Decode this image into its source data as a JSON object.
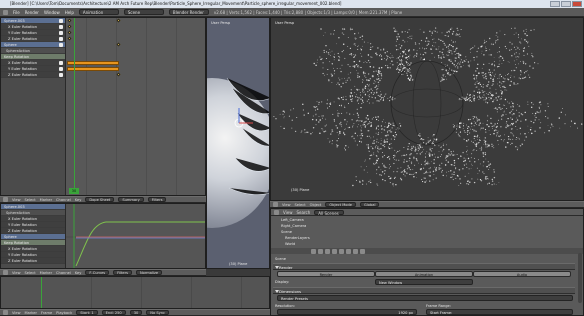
{
  "window": {
    "title": "[Blender] [C:\\Users\\Tom\\Documents\\Architecture\\2 AM Arch Future Rep\\Blender\\Particle_Sphere_Irregular_Movement\\Particle_sphere_irregular_movement_002.blend]"
  },
  "menubar": {
    "items": [
      "File",
      "Render",
      "Window",
      "Help"
    ],
    "layout": "Animation",
    "scene": "Scene",
    "engine": "Blender Render",
    "stats": "v2.68 | Verts:1,562 | Faces:1,440 | Tris:2,880 | Objects:1/3 | Lamps:0/0 | Mem:221.37M | Plane"
  },
  "dopesheet_top": {
    "channels": [
      {
        "label": "Sphere.003",
        "kind": "obj"
      },
      {
        "label": "X Euler Rotation",
        "kind": "fc"
      },
      {
        "label": "Y Euler Rotation",
        "kind": "fc"
      },
      {
        "label": "Z Euler Rotation",
        "kind": "fc"
      },
      {
        "label": "Sphere",
        "kind": "obj"
      },
      {
        "label": "SphereAction",
        "kind": "sub"
      },
      {
        "label": "Keep Rotation",
        "kind": "grp"
      },
      {
        "label": "X Euler Rotation",
        "kind": "fc"
      },
      {
        "label": "Y Euler Rotation",
        "kind": "fc"
      },
      {
        "label": "Z Euler Rotation",
        "kind": "fc"
      }
    ],
    "current_frame": "30",
    "header": {
      "view": "View",
      "select": "Select",
      "marker": "Marker",
      "channel": "Channel",
      "key": "Key",
      "mode": "Dope Sheet",
      "summary": "Summary",
      "filters": "Filters"
    }
  },
  "graph_editor": {
    "channels": [
      {
        "label": "Sphere.003",
        "kind": "obj"
      },
      {
        "label": "SphereAction",
        "kind": "sub"
      },
      {
        "label": "X Euler Rotation",
        "kind": "fc"
      },
      {
        "label": "Y Euler Rotation",
        "kind": "fc"
      },
      {
        "label": "Z Euler Rotation",
        "kind": "fc"
      },
      {
        "label": "Sphere",
        "kind": "obj"
      },
      {
        "label": "Keep Rotation",
        "kind": "grp"
      },
      {
        "label": "X Euler Rotation",
        "kind": "fc"
      },
      {
        "label": "Y Euler Rotation",
        "kind": "fc"
      },
      {
        "label": "Z Euler Rotation",
        "kind": "fc"
      }
    ],
    "header": {
      "view": "View",
      "select": "Select",
      "marker": "Marker",
      "channel": "Channel",
      "key": "Key",
      "mode": "F-Curves",
      "filters": "Filters",
      "normalize": "Normalize"
    }
  },
  "viewport_left": {
    "label": "User Persp",
    "object": "(30) Plane"
  },
  "viewport_main": {
    "label": "User Persp",
    "object": "(30) Plane",
    "header": {
      "view": "View",
      "select": "Select",
      "object": "Object",
      "mode": "Object Mode",
      "global": "Global"
    }
  },
  "properties": {
    "outliner_rows": [
      "Left_Camera",
      "Right_Camera",
      "Scene",
      "RenderLayers",
      "World"
    ],
    "header": {
      "view": "View",
      "search": "Search",
      "scene": "All Scenes"
    },
    "scene_label": "Scene",
    "render_panel": "Render",
    "render_btn": "Render",
    "animation_btn": "Animation",
    "audio_btn": "Audio",
    "display_label": "Display:",
    "display_value": "New Window",
    "dimensions_panel": "Dimensions",
    "presets": "Render Presets",
    "resolution_label": "Resolution:",
    "res_x": "1920 px",
    "frame_range_label": "Frame Range:",
    "start_frame": "Start Frame:"
  },
  "timeline": {
    "header": {
      "view": "View",
      "marker": "Marker",
      "frame": "Frame",
      "playback": "Playback",
      "start": "Start:",
      "start_val": "1",
      "end": "End:",
      "end_val": "250",
      "current": "30",
      "sync": "No Sync"
    }
  },
  "colors": {
    "keyframe": "#e8951e",
    "playhead": "#3aa43a",
    "object_channel": "#5b6f92"
  }
}
